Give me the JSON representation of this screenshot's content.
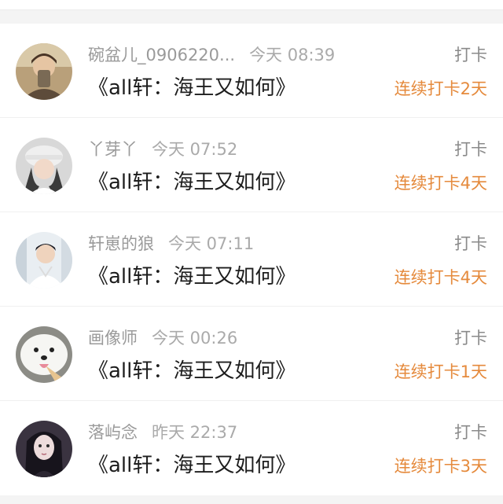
{
  "colors": {
    "streak": "#e58a3c",
    "name": "#9a9a9a",
    "title": "#1d1d1d"
  },
  "entries": [
    {
      "username": "碗盆儿_0906220...",
      "time": "今天 08:39",
      "title": "《all轩：海王又如何》",
      "action": "打卡",
      "streak": "连续打卡2天",
      "avatar_icon": "user-avatar-photo"
    },
    {
      "username": "丫芽丫",
      "time": "今天 07:52",
      "title": "《all轩：海王又如何》",
      "action": "打卡",
      "streak": "连续打卡4天",
      "avatar_icon": "user-avatar-photo"
    },
    {
      "username": "轩崽的狼",
      "time": "今天 07:11",
      "title": "《all轩：海王又如何》",
      "action": "打卡",
      "streak": "连续打卡4天",
      "avatar_icon": "user-avatar-photo"
    },
    {
      "username": "画像师",
      "time": "今天 00:26",
      "title": "《all轩：海王又如何》",
      "action": "打卡",
      "streak": "连续打卡1天",
      "avatar_icon": "dog-avatar-photo"
    },
    {
      "username": "落屿念",
      "time": "昨天 22:37",
      "title": "《all轩：海王又如何》",
      "action": "打卡",
      "streak": "连续打卡3天",
      "avatar_icon": "user-avatar-photo"
    }
  ]
}
